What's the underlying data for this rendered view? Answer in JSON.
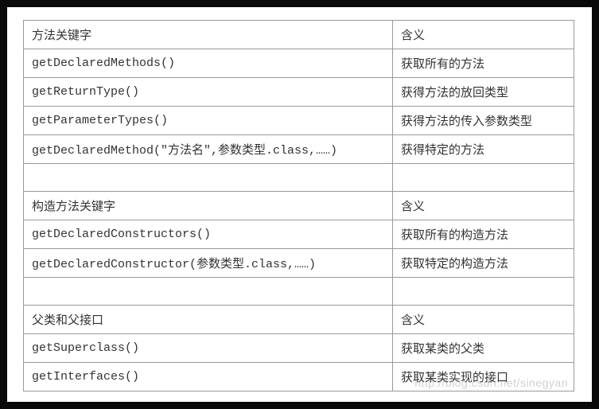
{
  "table": {
    "section1": {
      "header": {
        "left": "方法关键字",
        "right": "含义"
      },
      "rows": [
        {
          "left": "getDeclaredMethods()",
          "right": "获取所有的方法"
        },
        {
          "left": "getReturnType()",
          "right": "获得方法的放回类型"
        },
        {
          "left": "getParameterTypes()",
          "right": "获得方法的传入参数类型"
        },
        {
          "left": "getDeclaredMethod(\"方法名\",参数类型.class,……)",
          "right": "获得特定的方法"
        }
      ]
    },
    "section2": {
      "header": {
        "left": "构造方法关键字",
        "right": "含义"
      },
      "rows": [
        {
          "left": "getDeclaredConstructors()",
          "right": "获取所有的构造方法"
        },
        {
          "left": "getDeclaredConstructor(参数类型.class,……)",
          "right": "获取特定的构造方法"
        }
      ]
    },
    "section3": {
      "header": {
        "left": "父类和父接口",
        "right": "含义"
      },
      "rows": [
        {
          "left": "getSuperclass()",
          "right": "获取某类的父类"
        },
        {
          "left": "getInterfaces()",
          "right": "获取某类实现的接口"
        }
      ]
    }
  },
  "watermark": "http://blog.csdn.net/sinegyan"
}
